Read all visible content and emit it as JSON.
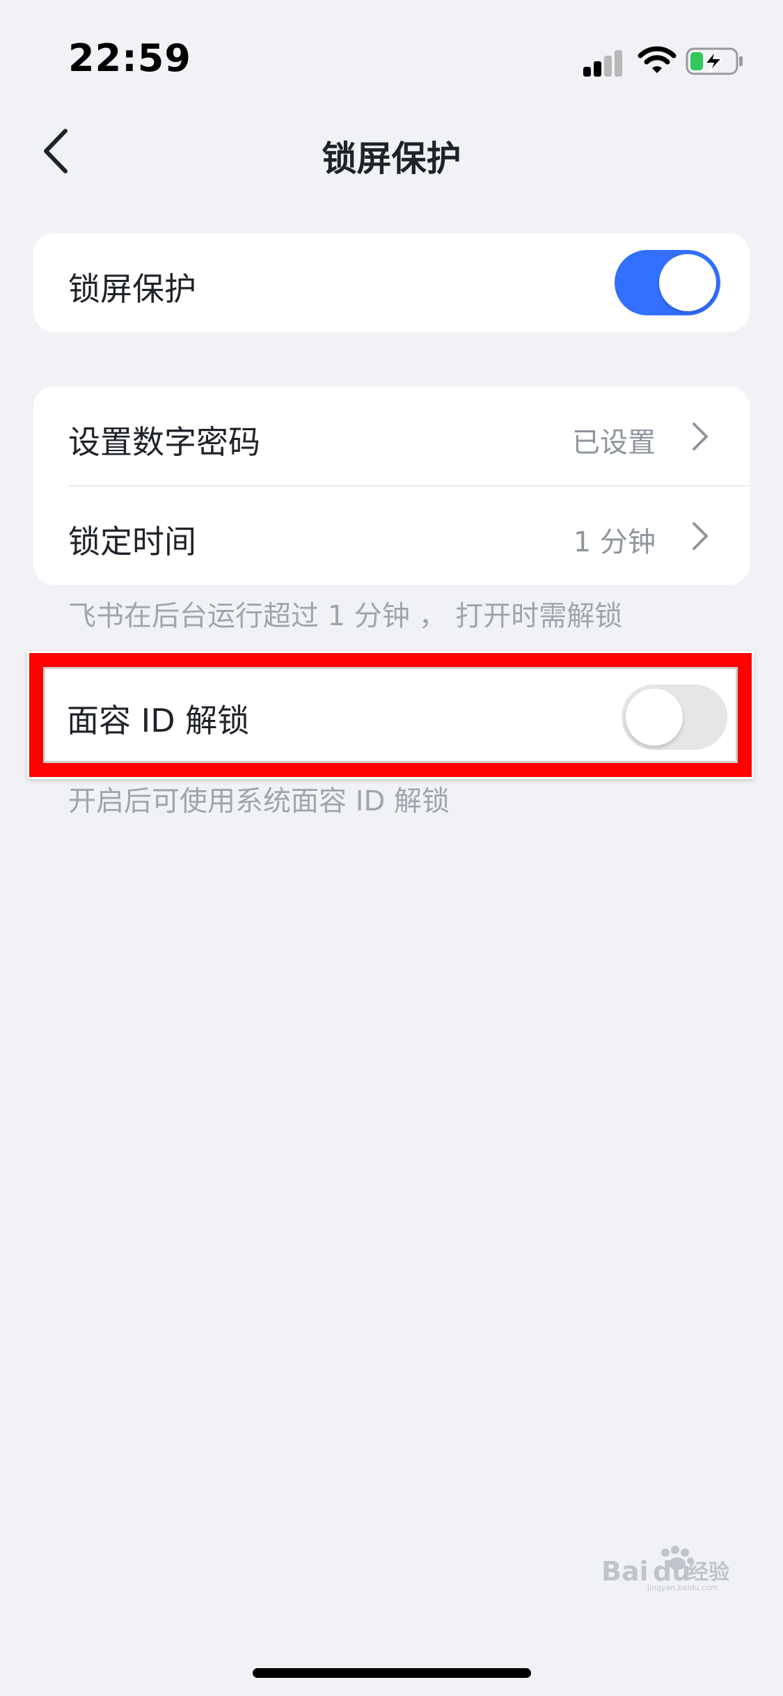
{
  "status_bar": {
    "time": "22:59",
    "signal_icon": "cellular-signal-icon",
    "wifi_icon": "wifi-icon",
    "battery_icon": "battery-charging-icon"
  },
  "nav": {
    "back_icon": "chevron-left-icon",
    "title": "锁屏保护"
  },
  "lock_protection": {
    "label": "锁屏保护",
    "enabled": true
  },
  "settings": {
    "passcode": {
      "label": "设置数字密码",
      "value": "已设置"
    },
    "lock_time": {
      "label": "锁定时间",
      "value": "1 分钟"
    },
    "lock_time_caption": "飞书在后台运行超过 1 分钟 ， 打开时需解锁"
  },
  "face_id": {
    "label": "面容 ID 解锁",
    "enabled": false,
    "caption": "开启后可使用系统面容 ID 解锁"
  },
  "colors": {
    "accent": "#3370ff",
    "highlight_border": "#ff0000",
    "background": "#f1f2f5"
  }
}
